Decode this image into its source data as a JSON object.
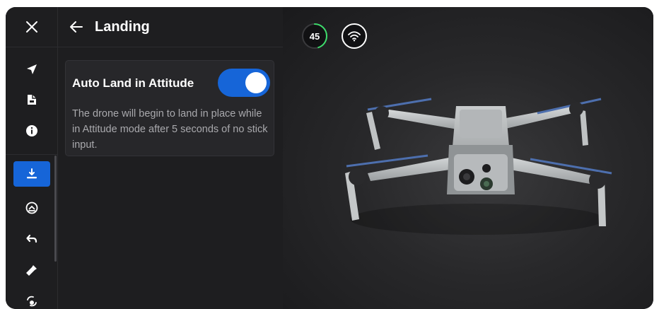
{
  "panel": {
    "title": "Landing"
  },
  "setting": {
    "label": "Auto Land in Attitude",
    "enabled": true,
    "description": "The drone will begin to land in place while in Attitude mode after 5 seconds of no stick input."
  },
  "status": {
    "battery_percent": "45"
  },
  "rail": {
    "items": [
      {
        "icon": "navigation-arrow-icon"
      },
      {
        "icon": "file-icon"
      },
      {
        "icon": "info-icon"
      },
      {
        "icon": "landing-icon",
        "active": true
      },
      {
        "icon": "takeoff-icon"
      },
      {
        "icon": "return-icon"
      },
      {
        "icon": "flashlight-icon"
      },
      {
        "icon": "camera-rotate-icon"
      }
    ]
  },
  "colors": {
    "accent": "#1665d8",
    "battery_ring": "#3ddc6b"
  }
}
